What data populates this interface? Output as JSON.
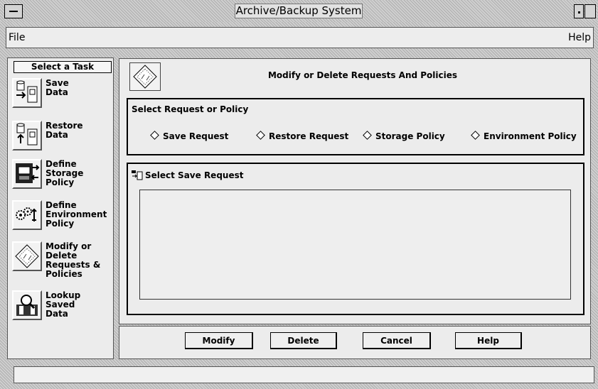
{
  "window": {
    "title": "Archive/Backup System"
  },
  "menubar": {
    "file": "File",
    "help": "Help"
  },
  "tasks": {
    "header": "Select a Task",
    "items": [
      {
        "label": "Save\nData",
        "icon": "save-data-icon"
      },
      {
        "label": "Restore\nData",
        "icon": "restore-data-icon"
      },
      {
        "label": "Define\nStorage\nPolicy",
        "icon": "storage-policy-icon"
      },
      {
        "label": "Define\nEnvironment\nPolicy",
        "icon": "environment-policy-icon"
      },
      {
        "label": "Modify or\nDelete\nRequests &\nPolicies",
        "icon": "modify-delete-icon"
      },
      {
        "label": "Lookup\nSaved\nData",
        "icon": "lookup-data-icon"
      }
    ]
  },
  "main": {
    "title": "Modify or Delete Requests And Policies",
    "select_group": {
      "title": "Select Request or Policy",
      "options": [
        "Save Request",
        "Restore Request",
        "Storage Policy",
        "Environment Policy"
      ],
      "selected": ""
    },
    "list": {
      "title": "Select Save Request",
      "items": []
    }
  },
  "buttons": {
    "modify": "Modify",
    "delete": "Delete",
    "cancel": "Cancel",
    "help": "Help"
  },
  "status": {
    "text": ""
  }
}
